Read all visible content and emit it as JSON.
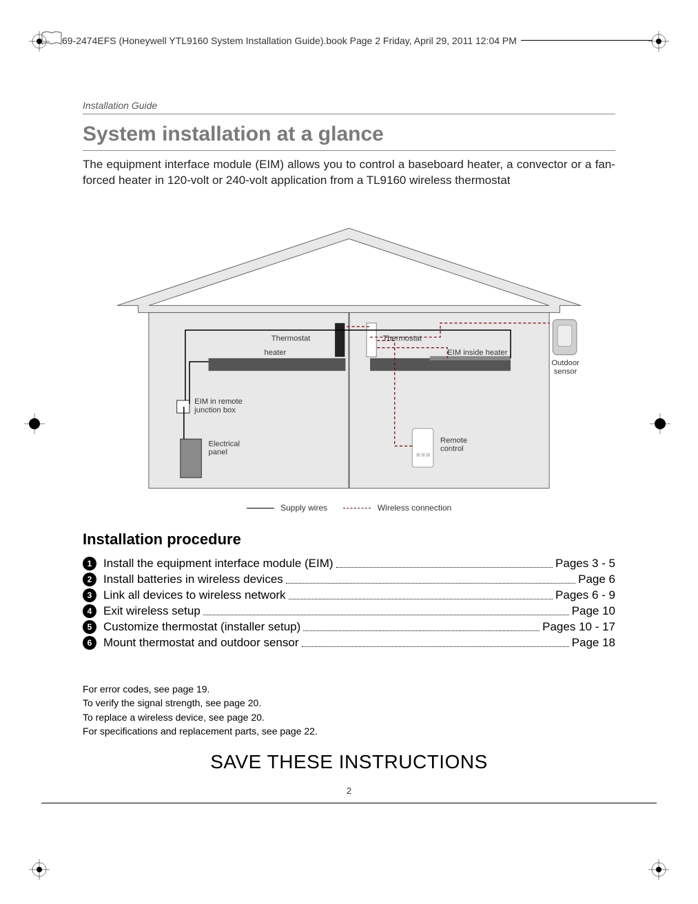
{
  "header": {
    "file_info": "69-2474EFS (Honeywell YTL9160 System Installation Guide).book  Page 2  Friday, April 29, 2011  12:04 PM"
  },
  "running_head": "Installation Guide",
  "title": "System installation at a glance",
  "intro": "The equipment interface module (EIM) allows you to control a baseboard heater, a convector or a fan-forced heater in 120-volt or 240-volt application from a TL9160 wireless thermostat",
  "diagram": {
    "labels": {
      "thermostat1": "Thermostat",
      "thermostat2": "Thermostat",
      "heater": "heater",
      "eim_inside": "EIM inside heater",
      "eim_remote": "EIM in remote junction box",
      "electrical_panel": "Electrical panel",
      "remote_control": "Remote control",
      "outdoor_sensor": "Outdoor sensor"
    }
  },
  "legend": {
    "supply": "Supply wires",
    "wireless": "Wireless connection"
  },
  "subheading": "Installation procedure",
  "procedure": [
    {
      "num": "1",
      "label": "Install the equipment interface module (EIM)",
      "page": "Pages 3 - 5"
    },
    {
      "num": "2",
      "label": "Install batteries in wireless devices",
      "page": "Page 6"
    },
    {
      "num": "3",
      "label": "Link all devices to wireless network",
      "page": "Pages 6 - 9"
    },
    {
      "num": "4",
      "label": "Exit wireless setup",
      "page": "Page 10"
    },
    {
      "num": "5",
      "label": "Customize thermostat (installer setup)",
      "page": "Pages 10 - 17"
    },
    {
      "num": "6",
      "label": "Mount thermostat and outdoor sensor",
      "page": "Page 18"
    }
  ],
  "notes": [
    "For error codes, see page 19.",
    "To verify the signal strength, see page 20.",
    "To replace a wireless device, see page 20.",
    "For specifications and replacement parts, see page 22."
  ],
  "save": "SAVE THESE INSTRUCTIONS",
  "page_number": "2"
}
